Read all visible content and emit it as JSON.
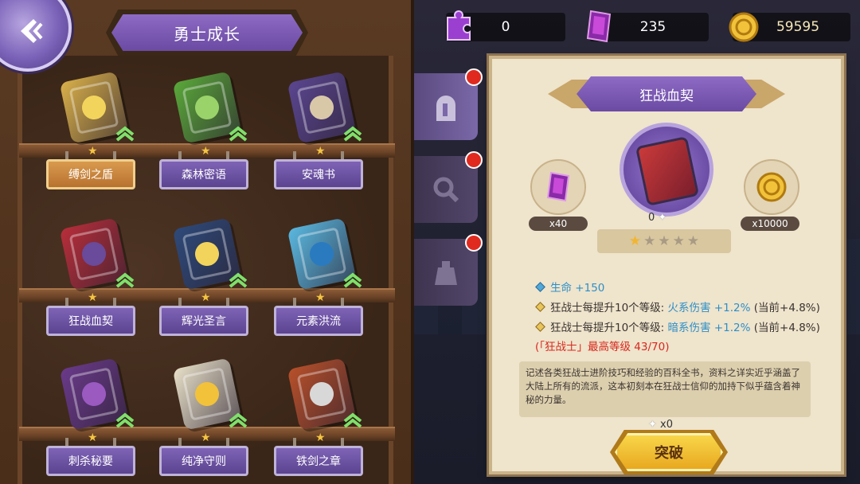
{
  "panel": {
    "title": "勇士成长"
  },
  "items": [
    {
      "name": "缚剑之盾",
      "stars": 1,
      "color": "#d9b04a",
      "emblem": "#f2d45c",
      "selected_label": true
    },
    {
      "name": "森林密语",
      "stars": 1,
      "color": "#5aa83a",
      "emblem": "#9ad36a",
      "selected_label": false
    },
    {
      "name": "安魂书",
      "stars": 1,
      "color": "#5a4690",
      "emblem": "#d9c8a8",
      "selected_label": false
    },
    {
      "name": "狂战血契",
      "stars": 1,
      "color": "#b82e3a",
      "emblem": "#6a4a9a",
      "selected_label": false
    },
    {
      "name": "辉光圣言",
      "stars": 1,
      "color": "#2e4a7a",
      "emblem": "#f2d45c",
      "selected_label": false
    },
    {
      "name": "元素洪流",
      "stars": 1,
      "color": "#5ab8e0",
      "emblem": "#2a7ac0",
      "selected_label": false
    },
    {
      "name": "刺杀秘要",
      "stars": 1,
      "color": "#6a3a8a",
      "emblem": "#9a5ac0",
      "selected_label": false
    },
    {
      "name": "纯净守则",
      "stars": 1,
      "color": "#e8e0c8",
      "emblem": "#f2c23a",
      "selected_label": false
    },
    {
      "name": "铁剑之章",
      "stars": 1,
      "color": "#b8502a",
      "emblem": "#d8d8d8",
      "selected_label": false
    }
  ],
  "resources": {
    "puzzle": "0",
    "gem": "235",
    "gold": "59595"
  },
  "detail": {
    "title": "狂战血契",
    "gem_cost": "x40",
    "gold_cost": "x10000",
    "fragments": "0",
    "stars_filled": 1,
    "stars_total": 5,
    "stat_hp_label": "生命",
    "stat_hp_value": "+150",
    "stat2_prefix": "狂战士每提升10个等级:",
    "stat2_effect": "火系伤害 +1.2%",
    "stat2_current": "(当前+4.8%)",
    "stat3_prefix": "狂战士每提升10个等级:",
    "stat3_effect": "暗系伤害 +1.2%",
    "stat3_current": "(当前+4.8%)",
    "max_level": "(「狂战士」最高等级 43/70)",
    "description": "记述各类狂战士进阶技巧和经验的百科全书，资料之详实近乎涵盖了大陆上所有的流派，这本初刻本在狂战士信仰的加持下似乎蕴含着神秘的力量。",
    "break_count": "x0",
    "break_label": "突破"
  },
  "colors": {
    "purple": "#7a5cb8",
    "gold": "#f2c23a",
    "red_dot": "#e02a20",
    "blue_text": "#2d8fc8",
    "red_text": "#d8281e"
  }
}
